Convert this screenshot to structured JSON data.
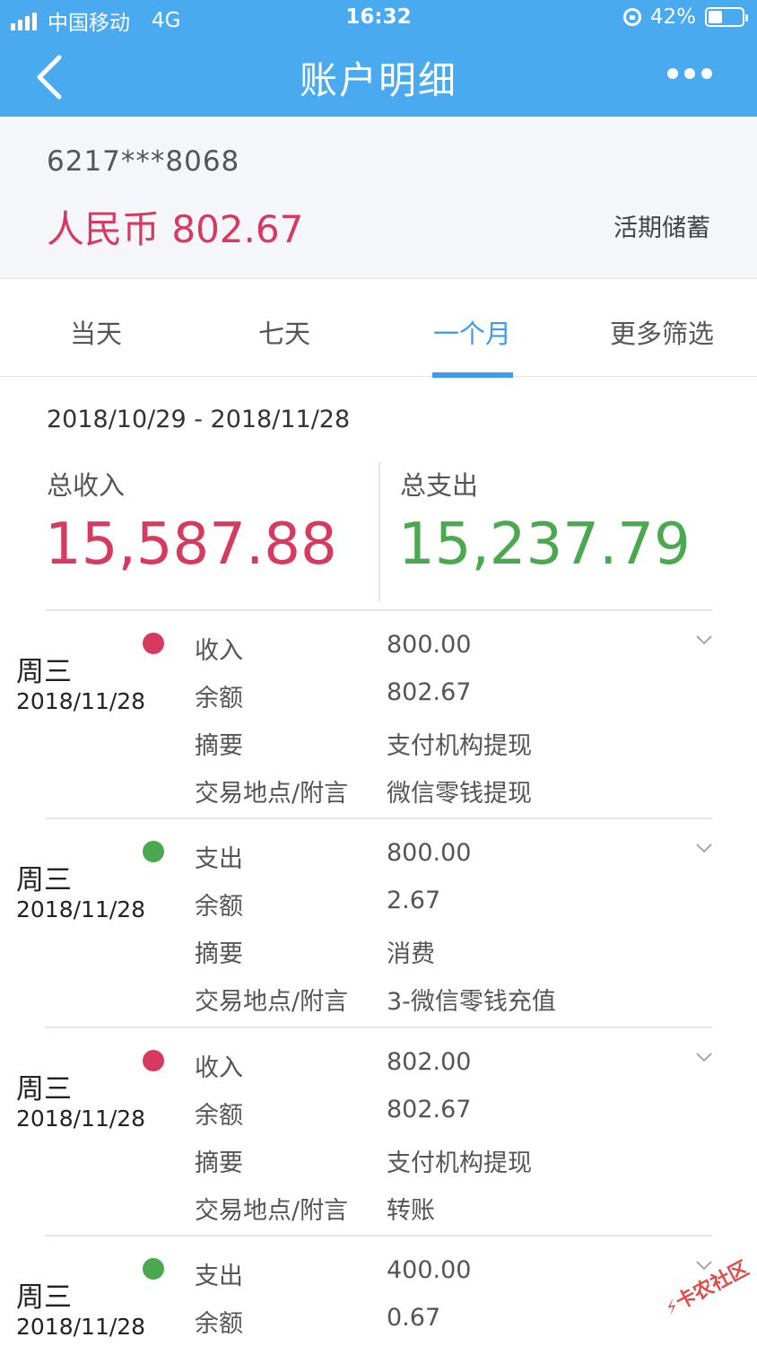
{
  "status_bar": {
    "carrier": "中国移动",
    "network": "4G",
    "time": "16:32",
    "battery": "42%",
    "battery_level": 0.42
  },
  "nav": {
    "title": "账户明细"
  },
  "account": {
    "number": "6217***8068",
    "balance": "人民币 802.67",
    "type": "活期储蓄"
  },
  "tabs": [
    {
      "label": "当天"
    },
    {
      "label": "七天"
    },
    {
      "label": "一个月",
      "active": true
    },
    {
      "label": "更多筛选"
    }
  ],
  "summary": {
    "date_range": "2018/10/29 - 2018/11/28",
    "income_label": "总收入",
    "income_value": "15,587.88",
    "expense_label": "总支出",
    "expense_value": "15,237.79"
  },
  "transactions": [
    {
      "day": "周三",
      "date": "2018/11/28",
      "dot": "red",
      "type_label": "收入",
      "amount": "800.00",
      "balance_label": "余额",
      "balance": "802.67",
      "summary_label": "摘要",
      "summary": "支付机构提现",
      "place_label": "交易地点/附言",
      "place": "微信零钱提现"
    },
    {
      "day": "周三",
      "date": "2018/11/28",
      "dot": "green",
      "type_label": "支出",
      "amount": "800.00",
      "balance_label": "余额",
      "balance": "2.67",
      "summary_label": "摘要",
      "summary": "消费",
      "place_label": "交易地点/附言",
      "place": "3-微信零钱充值"
    },
    {
      "day": "周三",
      "date": "2018/11/28",
      "dot": "red",
      "type_label": "收入",
      "amount": "802.00",
      "balance_label": "余额",
      "balance": "802.67",
      "summary_label": "摘要",
      "summary": "支付机构提现",
      "place_label": "交易地点/附言",
      "place": "转账"
    },
    {
      "day": "周三",
      "date": "2018/11/28",
      "dot": "green",
      "type_label": "支出",
      "amount": "400.00",
      "balance_label": "余额",
      "balance": "0.67"
    }
  ],
  "watermark": {
    "text": "卡农社区"
  },
  "colors": {
    "header": "#4aaaf0",
    "income": "#d63a5f",
    "expense": "#4aa84f",
    "active_tab": "#3d9bee"
  }
}
